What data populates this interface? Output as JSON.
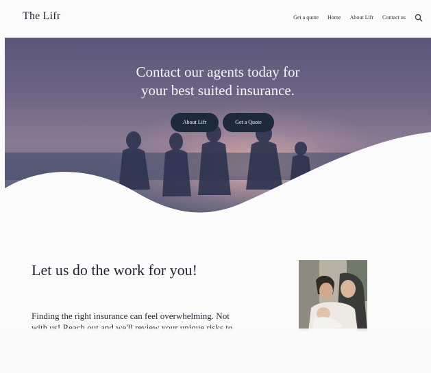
{
  "header": {
    "logo": "The Lifr",
    "nav": {
      "get_a_quote": "Get a quote",
      "home": "Home",
      "about": "About Lifr",
      "contact": "Contact us"
    },
    "search_icon": "search-icon"
  },
  "hero": {
    "title_line1": "Contact our agents today for",
    "title_line2": "your best suited insurance.",
    "about_button": "About Lifr",
    "quote_button": "Get a Quote"
  },
  "content": {
    "heading": "Let us do the work for you!",
    "body_line1": "Finding the right insurance can feel overwhelming. Not",
    "body_line2": "with us! Reach out and we'll review your unique risks to"
  },
  "colors": {
    "button_bg": "#1c2a3b",
    "page_bg": "#fbfbfb",
    "text": "#1f2430"
  }
}
